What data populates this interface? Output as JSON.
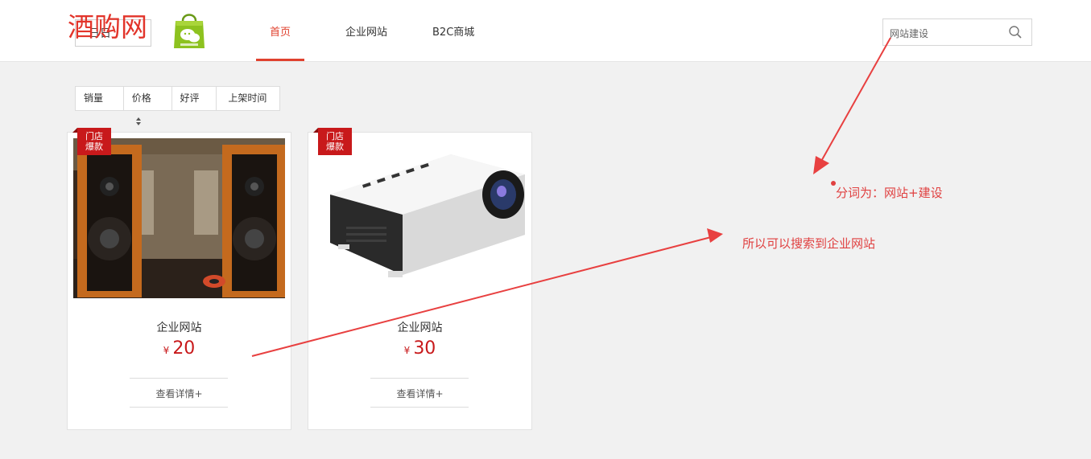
{
  "header": {
    "logo_small": "日日",
    "logo_big": "酒购网",
    "nav": [
      "首页",
      "企业网站",
      "B2C商城"
    ],
    "active_index": 0
  },
  "search": {
    "value": "网站建设",
    "icon": "search-icon"
  },
  "sortbar": {
    "items": [
      "销量",
      "价格",
      "好评",
      "上架时间"
    ]
  },
  "products": [
    {
      "badge_line1": "门店",
      "badge_line2": "爆款",
      "name": "企业网站",
      "currency": "¥",
      "price": "20",
      "link": "查看详情+",
      "image": "speakers"
    },
    {
      "badge_line1": "门店",
      "badge_line2": "爆款",
      "name": "企业网站",
      "currency": "¥",
      "price": "30",
      "link": "查看详情+",
      "image": "projector"
    }
  ],
  "annotations": {
    "segmentation": "分词为：网站+建设",
    "explanation": "所以可以搜索到企业网站"
  },
  "colors": {
    "accent": "#e0412e",
    "badge": "#c8191b",
    "annotation": "#e04040"
  }
}
